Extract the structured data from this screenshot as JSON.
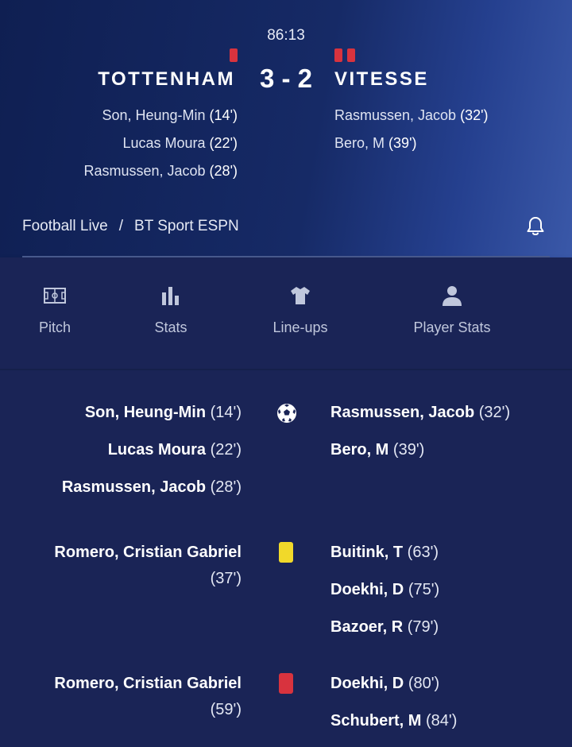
{
  "match": {
    "clock": "86:13",
    "home_team": "TOTTENHAM",
    "away_team": "VITESSE",
    "score": "3 - 2",
    "home_red_cards": 1,
    "away_red_cards": 2,
    "home_scorers": [
      {
        "name": "Son, Heung-Min",
        "minute": "(14')"
      },
      {
        "name": "Lucas Moura",
        "minute": "(22')"
      },
      {
        "name": "Rasmussen, Jacob",
        "minute": "(28')"
      }
    ],
    "away_scorers": [
      {
        "name": "Rasmussen, Jacob",
        "minute": "(32')"
      },
      {
        "name": "Bero, M",
        "minute": "(39')"
      }
    ]
  },
  "breadcrumb": {
    "section": "Football Live",
    "separator": "/",
    "channel": "BT Sport ESPN",
    "icon": "bell-icon"
  },
  "tabs": [
    {
      "label": "Pitch",
      "icon": "pitch-icon"
    },
    {
      "label": "Stats",
      "icon": "bar-chart-icon"
    },
    {
      "label": "Line-ups",
      "icon": "shirt-icon"
    },
    {
      "label": "Player Stats",
      "icon": "person-icon"
    }
  ],
  "events": {
    "goals": {
      "icon": "football-icon",
      "home": [
        {
          "name": "Son, Heung-Min",
          "minute": "(14')"
        },
        {
          "name": "Lucas Moura",
          "minute": "(22')"
        },
        {
          "name": "Rasmussen, Jacob",
          "minute": "(28')"
        }
      ],
      "away": [
        {
          "name": "Rasmussen, Jacob",
          "minute": "(32')"
        },
        {
          "name": "Bero, M",
          "minute": "(39')"
        }
      ]
    },
    "yellow_cards": {
      "icon": "yellow-card-icon",
      "home": [
        {
          "name": "Romero, Cristian Gabriel",
          "minute": "(37')"
        }
      ],
      "away": [
        {
          "name": "Buitink, T",
          "minute": "(63')"
        },
        {
          "name": "Doekhi, D",
          "minute": "(75')"
        },
        {
          "name": "Bazoer, R",
          "minute": "(79')"
        }
      ]
    },
    "red_cards": {
      "icon": "red-card-icon",
      "home": [
        {
          "name": "Romero, Cristian Gabriel",
          "minute": "(59')"
        }
      ],
      "away": [
        {
          "name": "Doekhi, D",
          "minute": "(80')"
        },
        {
          "name": "Schubert, M",
          "minute": "(84')"
        }
      ]
    }
  },
  "colors": {
    "background": "#1a2456",
    "red_card": "#d8333e",
    "yellow_card": "#f1d92a",
    "text": "#ffffff"
  }
}
